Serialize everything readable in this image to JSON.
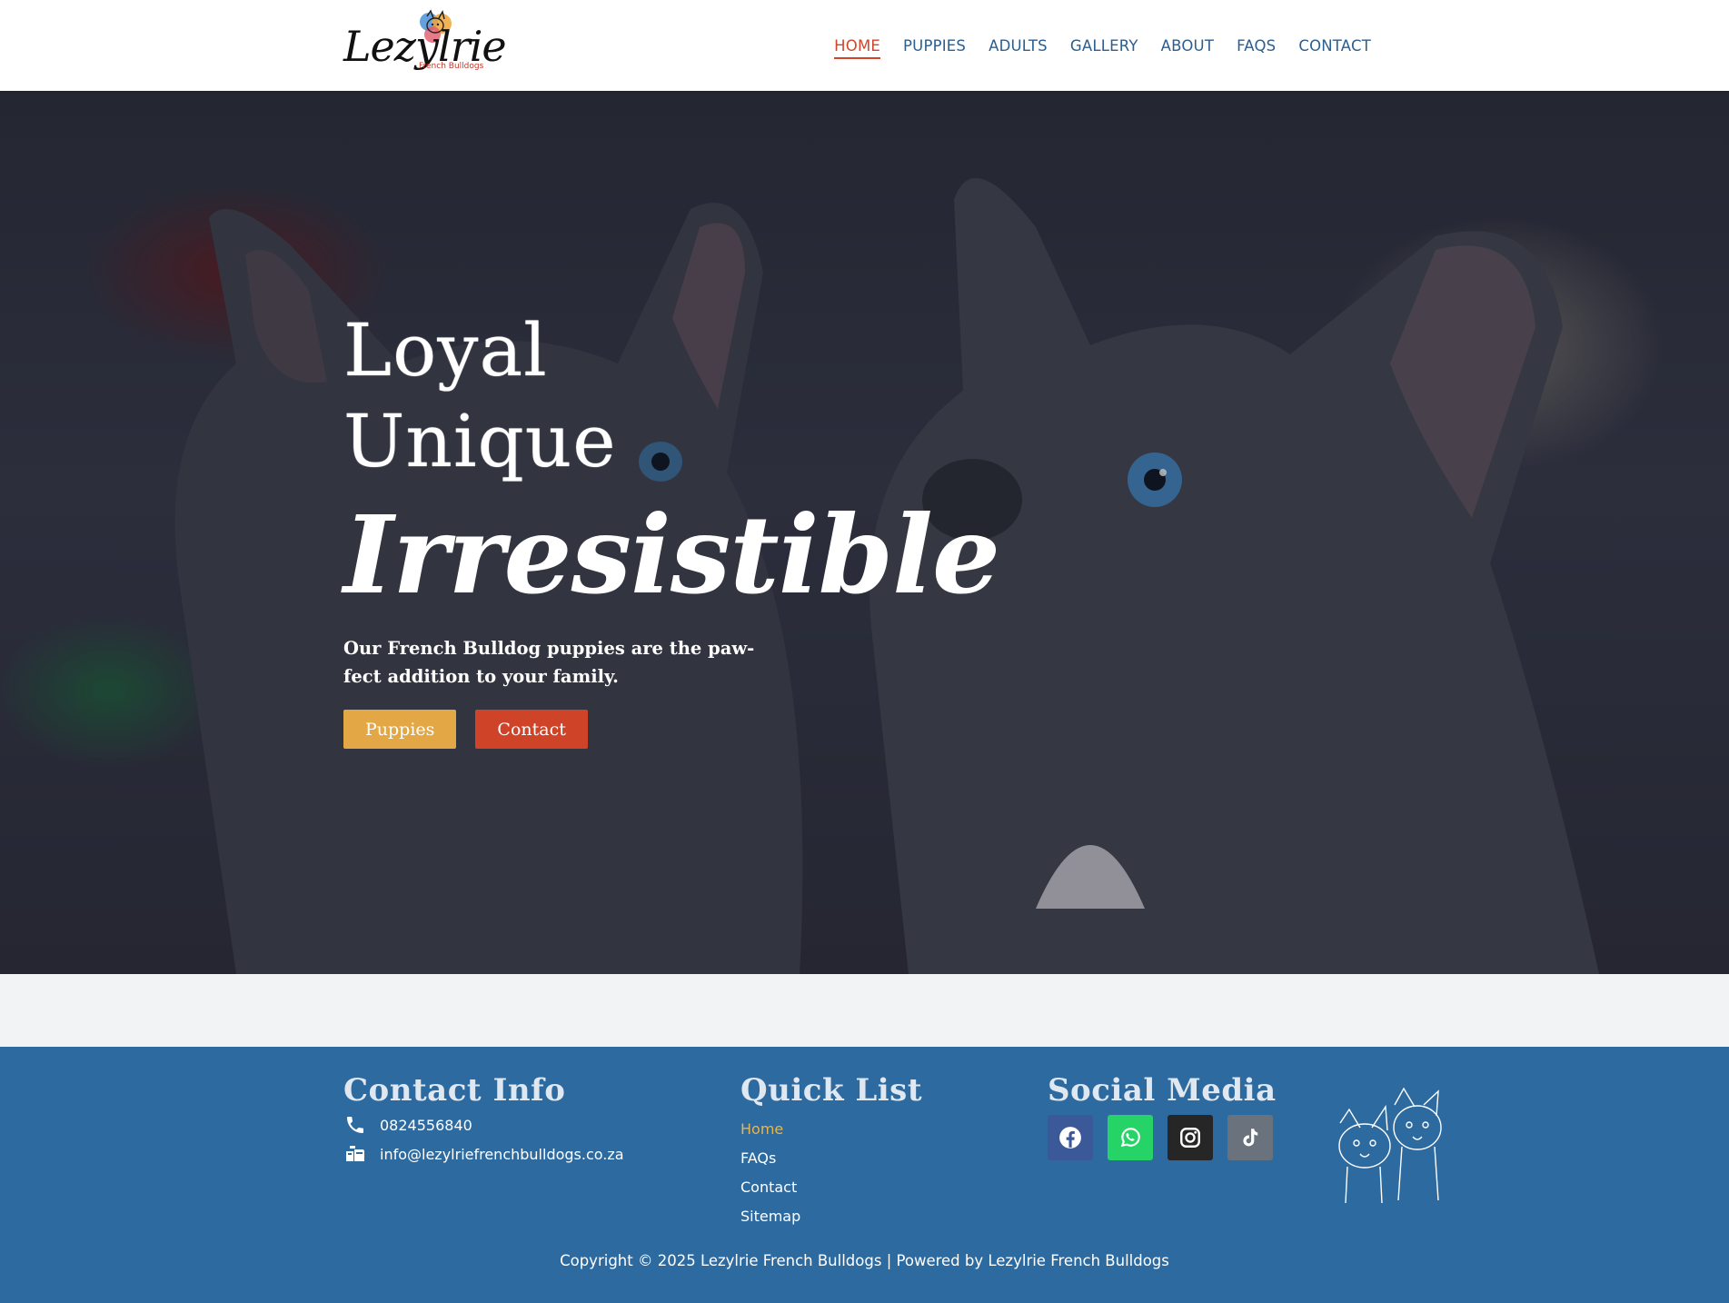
{
  "brand": {
    "name": "Lezylrie",
    "sub": "French Bulldogs"
  },
  "nav": {
    "items": [
      {
        "label": "HOME",
        "active": true
      },
      {
        "label": "PUPPIES",
        "active": false
      },
      {
        "label": "ADULTS",
        "active": false
      },
      {
        "label": "GALLERY",
        "active": false
      },
      {
        "label": "ABOUT",
        "active": false
      },
      {
        "label": "FAQS",
        "active": false
      },
      {
        "label": "CONTACT",
        "active": false
      }
    ]
  },
  "hero": {
    "line1": "Loyal",
    "line2": "Unique",
    "line3": "Irresistible",
    "tagline": "Our French Bulldog puppies are the paw-fect addition to your family.",
    "btn_puppies": "Puppies",
    "btn_contact": "Contact"
  },
  "footer": {
    "contact_title": "Contact Info",
    "phone": "0824556840",
    "email": "info@lezylriefrenchbulldogs.co.za",
    "quick_title": "Quick List",
    "quick_links": [
      "Home",
      "FAQs",
      "Contact",
      "Sitemap"
    ],
    "social_title": "Social Media",
    "social": [
      {
        "icon": "facebook-icon",
        "color": "#3b5998"
      },
      {
        "icon": "whatsapp-icon",
        "color": "#25d366"
      },
      {
        "icon": "instagram-icon",
        "color": "#262626"
      },
      {
        "icon": "tiktok-icon",
        "color": "#69727d"
      }
    ],
    "copyright": "Copyright © 2025 Lezylrie French Bulldogs | Powered by Lezylrie French Bulldogs"
  },
  "colors": {
    "nav_text": "#2c5e8f",
    "nav_active": "#d2452a",
    "footer_bg": "#2d6a9f",
    "btn_yellow": "#e3a845",
    "btn_red": "#cf4429",
    "quick_active": "#e8b54a"
  }
}
